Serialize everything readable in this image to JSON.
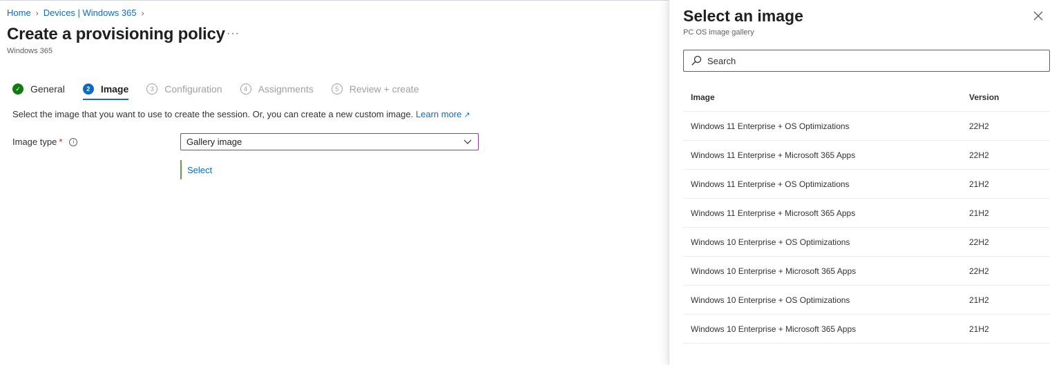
{
  "breadcrumb": {
    "home": "Home",
    "devices": "Devices | Windows 365"
  },
  "page": {
    "title": "Create a provisioning policy",
    "more": "···",
    "subtitle": "Windows 365"
  },
  "tabs": [
    {
      "num": "✓",
      "label": "General",
      "state": "done"
    },
    {
      "num": "2",
      "label": "Image",
      "state": "active"
    },
    {
      "num": "3",
      "label": "Configuration",
      "state": "todo"
    },
    {
      "num": "4",
      "label": "Assignments",
      "state": "todo"
    },
    {
      "num": "5",
      "label": "Review + create",
      "state": "todo"
    }
  ],
  "description": {
    "text": "Select the image that you want to use to create the session. Or, you can create a new custom image.",
    "link": "Learn more"
  },
  "image_type": {
    "label": "Image type",
    "required": "*",
    "value": "Gallery image",
    "select_link": "Select"
  },
  "blade": {
    "title": "Select an image",
    "subtitle": "PC OS image gallery",
    "search_placeholder": "Search",
    "columns": {
      "image": "Image",
      "version": "Version"
    },
    "rows": [
      {
        "image": "Windows 11 Enterprise + OS Optimizations",
        "version": "22H2"
      },
      {
        "image": "Windows 11 Enterprise + Microsoft 365 Apps",
        "version": "22H2"
      },
      {
        "image": "Windows 11 Enterprise + OS Optimizations",
        "version": "21H2"
      },
      {
        "image": "Windows 11 Enterprise + Microsoft 365 Apps",
        "version": "21H2"
      },
      {
        "image": "Windows 10 Enterprise + OS Optimizations",
        "version": "22H2"
      },
      {
        "image": "Windows 10 Enterprise + Microsoft 365 Apps",
        "version": "22H2"
      },
      {
        "image": "Windows 10 Enterprise + OS Optimizations",
        "version": "21H2"
      },
      {
        "image": "Windows 10 Enterprise + Microsoft 365 Apps",
        "version": "21H2"
      }
    ]
  },
  "colors": {
    "accent": "#0f6cbd",
    "success": "#107c10",
    "required": "#a4262c",
    "focus_border": "#8a3b9a",
    "select_bar": "#5ea33b"
  }
}
